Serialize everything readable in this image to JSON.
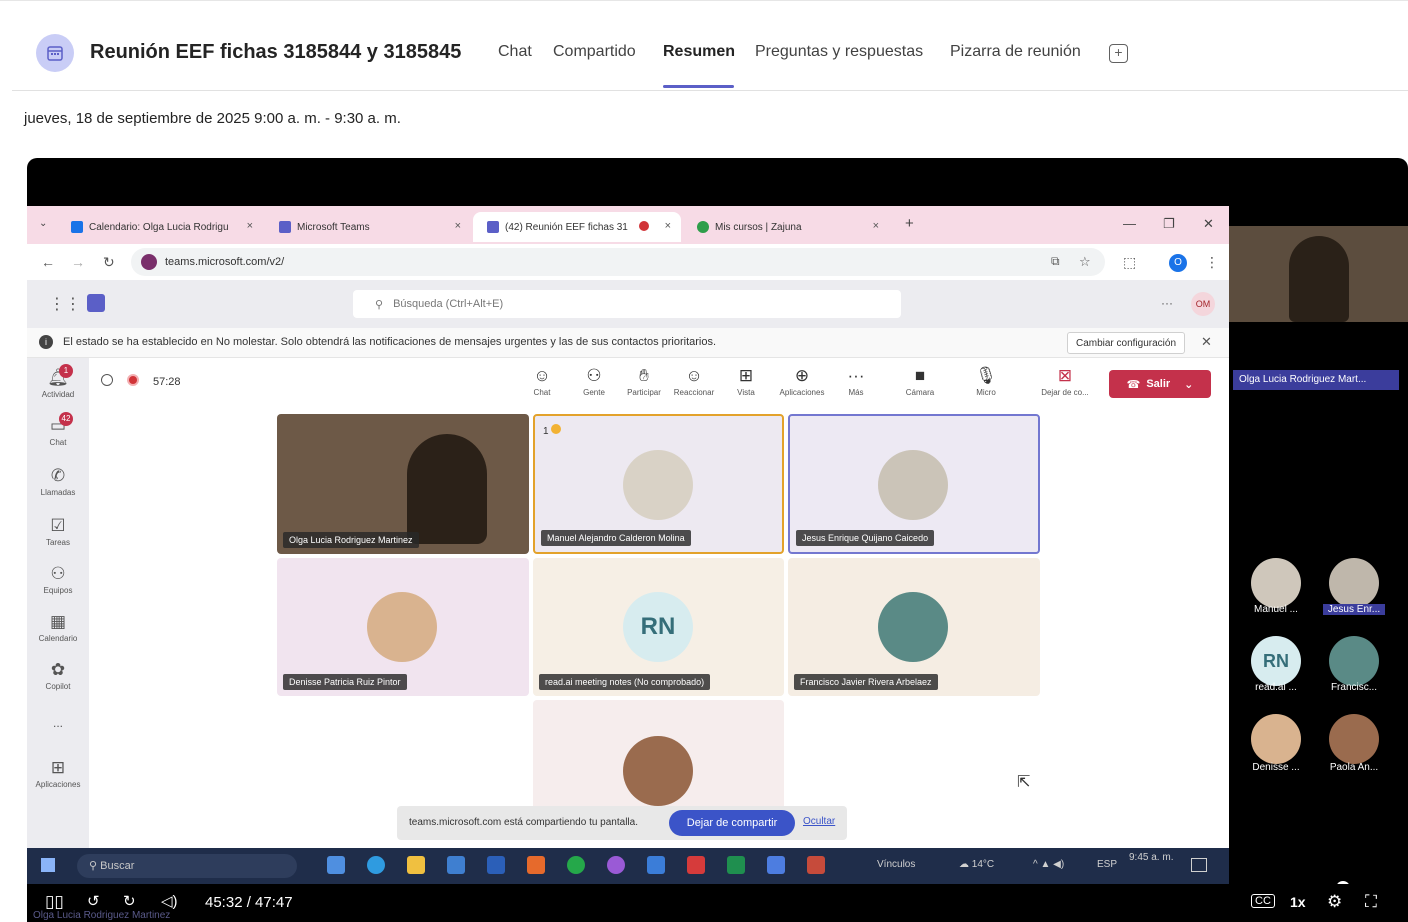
{
  "header": {
    "title": "Reunión EEF fichas 3185844 y 3185845",
    "tabs": [
      "Chat",
      "Compartido",
      "Resumen",
      "Preguntas y respuestas",
      "Pizarra de reunión"
    ],
    "active_tab": "Resumen",
    "add_tab": "+"
  },
  "meeting_date": "jueves, 18 de septiembre de 2025 9:00 a. m. - 9:30 a. m.",
  "browser": {
    "tabs": [
      {
        "label": "Calendario: Olga Lucia Rodrigu",
        "close": "×"
      },
      {
        "label": "Microsoft Teams",
        "close": "×"
      },
      {
        "label": "(42) Reunión EEF fichas 31",
        "close": "×"
      },
      {
        "label": "Mis cursos | Zajuna",
        "close": "×"
      }
    ],
    "new_tab": "+",
    "url": "teams.microsoft.com/v2/",
    "profile": "O"
  },
  "teams": {
    "search_placeholder": "Búsqueda (Ctrl+Alt+E)",
    "user_initials": "OM",
    "notification": "El estado se ha establecido en No molestar. Solo obtendrá las notificaciones de mensajes urgentes y las de sus contactos prioritarios.",
    "notification_button": "Cambiar configuración",
    "rail": [
      {
        "label": "Actividad",
        "badge": "1"
      },
      {
        "label": "Chat",
        "badge": "42"
      },
      {
        "label": "Llamadas",
        "badge": ""
      },
      {
        "label": "Tareas",
        "badge": ""
      },
      {
        "label": "Equipos",
        "badge": ""
      },
      {
        "label": "Calendario",
        "badge": ""
      },
      {
        "label": "Copilot",
        "badge": ""
      },
      {
        "label": "...",
        "badge": ""
      },
      {
        "label": "Aplicaciones",
        "badge": ""
      }
    ],
    "timer": "57:28",
    "toolbar": [
      {
        "label": "Chat"
      },
      {
        "label": "Gente"
      },
      {
        "label": "Participar"
      },
      {
        "label": "Reaccionar"
      },
      {
        "label": "Vista"
      },
      {
        "label": "Aplicaciones"
      },
      {
        "label": "Más"
      },
      {
        "label": "Cámara"
      },
      {
        "label": "Micro"
      },
      {
        "label": "Dejar de co..."
      }
    ],
    "leave_label": "Salir",
    "participants": [
      "Olga Lucia Rodriguez Martinez",
      "Manuel Alejandro Calderon Molina",
      "Jesus Enrique Quijano Caicedo",
      "Denisse Patricia Ruiz Pintor",
      "read.ai meeting notes (No comprobado)",
      "Francisco Javier Rivera Arbelaez"
    ],
    "raised_hand_count": "1",
    "rn_initials": "RN",
    "share_text": "teams.microsoft.com está compartiendo tu pantalla.",
    "share_stop": "Dejar de compartir",
    "share_hide": "Ocultar"
  },
  "taskbar": {
    "search": "Buscar",
    "links": "Vínculos",
    "weather": "14°C",
    "lang": "ESP",
    "time": "9:45 a. m."
  },
  "side_panel": {
    "main_name": "Olga Lucia Rodriguez Mart...",
    "people": [
      {
        "name": "Manuel ...",
        "initials": ""
      },
      {
        "name": "Jesus Enr...",
        "initials": ""
      },
      {
        "name": "read.ai ...",
        "initials": "RN"
      },
      {
        "name": "Francisc...",
        "initials": ""
      },
      {
        "name": "Denisse ...",
        "initials": ""
      },
      {
        "name": "Paola An...",
        "initials": ""
      }
    ]
  },
  "player": {
    "time": "45:32 / 47:47",
    "speed": "1x",
    "speaker_caption": "Olga Lucia Rodriguez Martinez",
    "progress": 0.953
  }
}
